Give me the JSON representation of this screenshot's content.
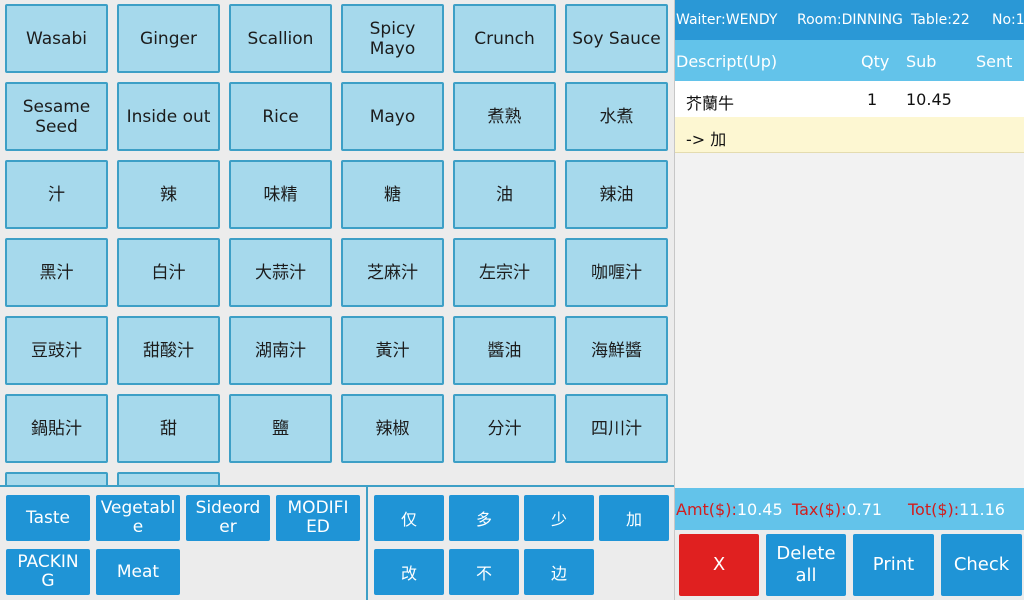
{
  "grid": {
    "buttons": [
      "Wasabi",
      "Ginger",
      "Scallion",
      "Spicy\nMayo",
      "Crunch",
      "Soy Sauce",
      "Sesame\nSeed",
      "Inside out",
      "Rice",
      "Mayo",
      "煮熟",
      "水煮",
      "汁",
      "辣",
      "味精",
      "糖",
      "油",
      "辣油",
      "黑汁",
      "白汁",
      "大蒜汁",
      "芝麻汁",
      "左宗汁",
      "咖喱汁",
      "豆豉汁",
      "甜酸汁",
      "湖南汁",
      "黃汁",
      "醬油",
      "海鮮醬",
      "鍋貼汁",
      "甜",
      "鹽",
      "辣椒",
      "分汁",
      "四川汁",
      "",
      ""
    ]
  },
  "categories": [
    "Taste",
    "Vegetabl\ne",
    "Sideord\ner",
    "MODIFI\nED",
    "PACKIN\nG",
    "Meat"
  ],
  "keywords": [
    "仅",
    "多",
    "少",
    "加",
    "改",
    "不",
    "边"
  ],
  "header": {
    "waiter": "Waiter:WENDY",
    "room": "Room:DINNING",
    "table": "Table:22",
    "no": "No:1"
  },
  "columns": {
    "descript": "Descript(Up)",
    "qty": "Qty",
    "sub": "Sub",
    "sent": "Sent"
  },
  "order": {
    "item": {
      "name": "芥蘭牛",
      "qty": "1",
      "sub": "10.45",
      "sent": ""
    },
    "modifier": "-> 加"
  },
  "totals": {
    "amt_label": "Amt($):",
    "amt": "10.45",
    "tax_label": "Tax($):",
    "tax": "0.71",
    "tot_label": "Tot($):",
    "tot": "11.16"
  },
  "actions": {
    "cancel": "X",
    "delete_all": "Delete\nall",
    "print": "Print",
    "check": "Check"
  },
  "colors": {
    "grid_button": "#a6d9ec",
    "grid_border": "#3d9fc6",
    "category_button": "#1f94d6",
    "header": "#2a98d6",
    "column_header": "#63c3ea",
    "cancel_button": "#e02020",
    "modifier_row": "#fdf7d2",
    "totals_label": "#d21d1d"
  }
}
